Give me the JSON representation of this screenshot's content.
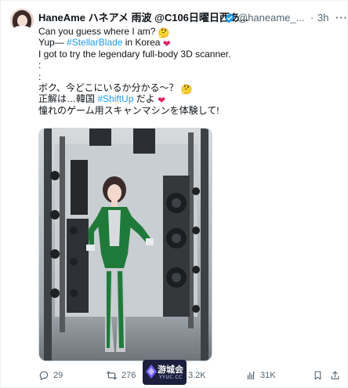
{
  "tweet": {
    "display_name": "HaneAme ハネアメ 雨波 @C106日曜日西あ...",
    "handle": "@haneame_...",
    "dot": "·",
    "time": "3h",
    "more": "···",
    "lines": {
      "l1": "Can you guess where I am?",
      "l2_pre": "Yup— ",
      "l2_tag": "#StellarBlade",
      "l2_post": " in Korea",
      "l3": "I got to try the legendary full-body 3D scanner.",
      "l4": ":",
      "l5": ":",
      "l6": "ボク、今どこにいるか分かる～？",
      "l7_pre": "正解は…韓国 ",
      "l7_tag": "#ShiftUp",
      "l7_post": " だよ",
      "l8": "憧れのゲーム用スキャンマシンを体験して!"
    },
    "emoji": {
      "l1": "🤔",
      "l2": "❤",
      "l6": "🤔",
      "l7": "❤"
    }
  },
  "actions": {
    "replies": "29",
    "retweets": "276",
    "likes": "3.2K",
    "views": "31K"
  },
  "watermark": {
    "text": "游城会",
    "sub": "YYUC.CC"
  },
  "colors": {
    "accent": "#1d9bf0",
    "text": "#0f1419",
    "secondary": "#536471",
    "heart": "#e0245e"
  }
}
